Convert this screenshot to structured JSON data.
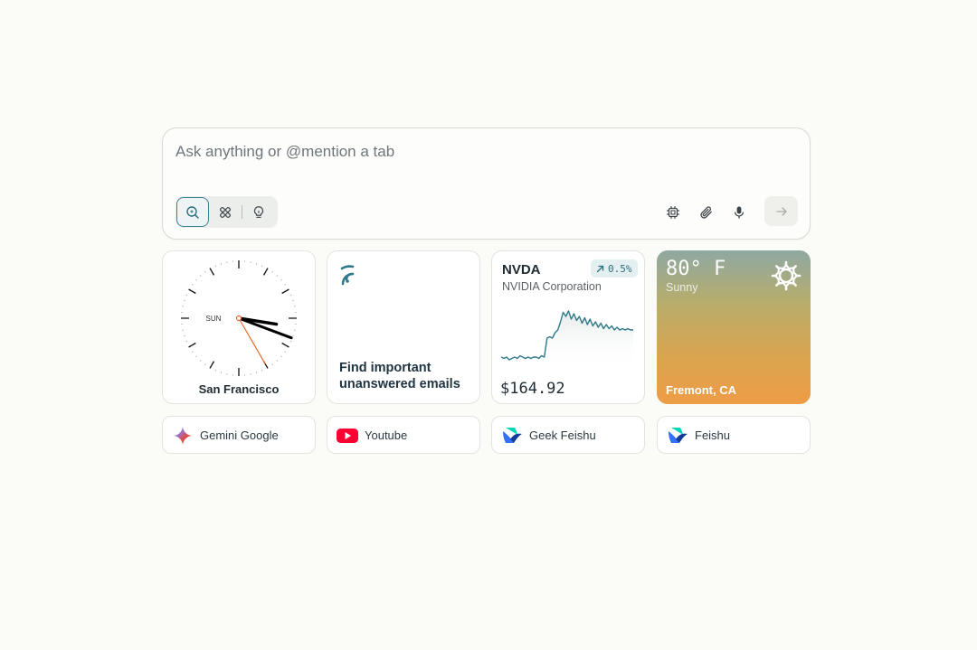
{
  "search": {
    "placeholder": "Ask anything or @mention a tab",
    "value": "",
    "modes": [
      {
        "name": "search",
        "icon": "search-sparkle-icon",
        "active": true
      },
      {
        "name": "tools",
        "icon": "tools-icon",
        "active": false
      },
      {
        "name": "ideas",
        "icon": "lightbulb-icon",
        "active": false
      }
    ],
    "actions": [
      "chip-icon",
      "paperclip-icon",
      "microphone-icon"
    ],
    "send_icon": "arrow-right-icon"
  },
  "clock_widget": {
    "day": "SUN",
    "city": "San Francisco",
    "time": {
      "hours": 3,
      "minutes": 18,
      "seconds": 25
    }
  },
  "task_widget": {
    "icon": "signal-waves-icon",
    "text_line1": "Find important",
    "text_line2": "unanswered emails"
  },
  "stock_widget": {
    "ticker": "NVDA",
    "company": "NVIDIA Corporation",
    "change": "0.5%",
    "price": "$164.92",
    "accent": "#2f7a8a"
  },
  "weather_widget": {
    "temp": "80° F",
    "condition": "Sunny",
    "location": "Fremont, CA",
    "icon": "sun-icon"
  },
  "shortcuts": [
    {
      "label": "Gemini Google",
      "icon": "gemini-icon"
    },
    {
      "label": "Youtube",
      "icon": "youtube-icon"
    },
    {
      "label": "Geek Feishu",
      "icon": "feishu-icon"
    },
    {
      "label": "Feishu",
      "icon": "feishu-icon"
    }
  ],
  "chart_data": {
    "type": "line",
    "title": "",
    "series": [
      {
        "values": [
          138,
          137,
          138,
          136,
          137,
          138,
          137,
          139,
          138,
          137,
          138,
          137,
          138,
          138,
          137,
          139,
          138,
          152,
          153,
          152,
          156,
          158,
          164,
          171,
          168,
          172,
          166,
          170,
          165,
          168,
          163,
          167,
          162,
          166,
          161,
          164,
          160,
          163,
          159,
          162,
          159,
          161,
          158,
          160,
          158,
          159,
          158,
          159,
          158,
          158
        ]
      }
    ],
    "ylim": [
      132,
      176
    ]
  }
}
